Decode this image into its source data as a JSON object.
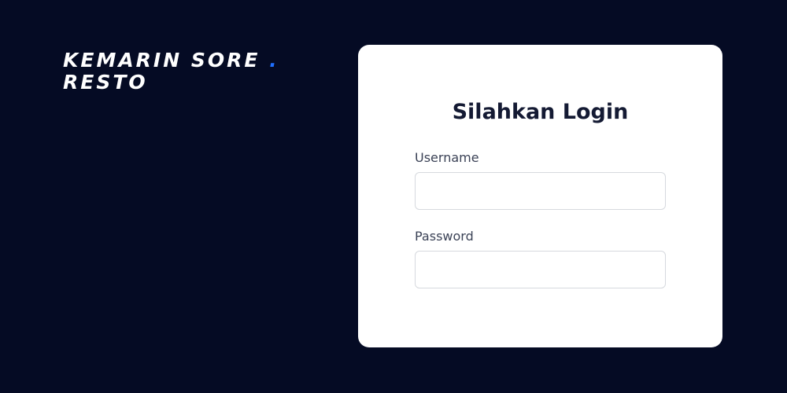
{
  "brand": {
    "line1": "KEMARIN SORE",
    "dot": ".",
    "line2": "RESTO"
  },
  "login": {
    "title": "Silahkan Login",
    "username_label": "Username",
    "username_value": "",
    "password_label": "Password",
    "password_value": ""
  },
  "colors": {
    "background": "#050b24",
    "card": "#ffffff",
    "accent_dot": "#1f6fff",
    "title_text": "#141a33",
    "label_text": "#3b4256",
    "input_border": "#d6d9de"
  }
}
